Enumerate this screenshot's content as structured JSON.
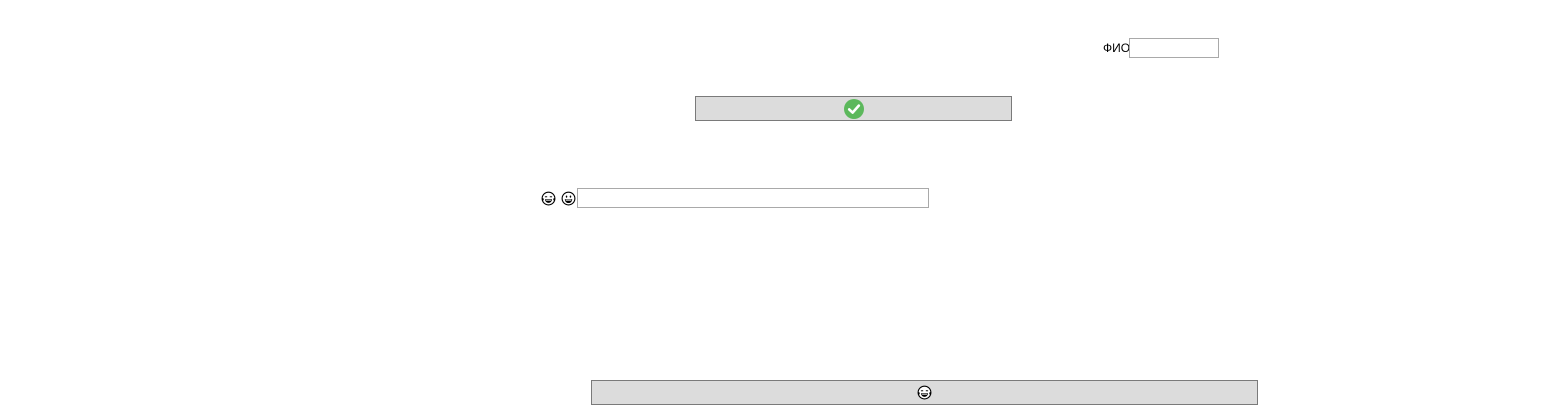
{
  "form": {
    "fio_label": "ФИО",
    "fio_value": "",
    "submit_icon": "check-circle-icon",
    "submit_icon_color": "#5cb85c",
    "emoji_row": {
      "icon1": "laughing-tears-emoji-icon",
      "icon2": "grinning-face-emoji-icon",
      "input_value": ""
    },
    "bottom_button_icon": "laughing-tears-emoji-icon"
  },
  "colors": {
    "button_bg": "#dcdcdc",
    "button_border": "#7a7a7a",
    "input_border": "#a9a9a9"
  }
}
